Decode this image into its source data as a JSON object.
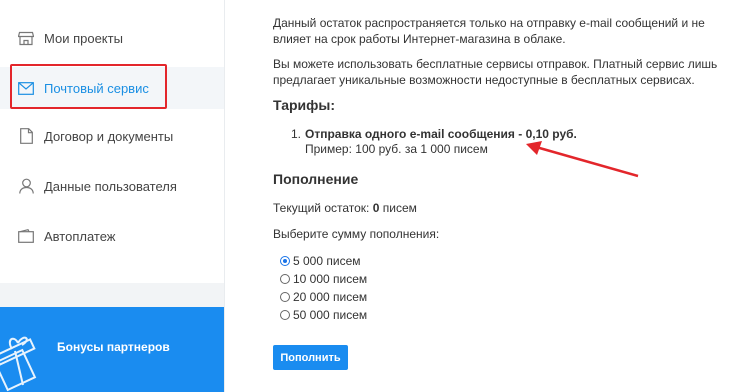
{
  "sidebar": {
    "items": [
      {
        "label": "Мои проекты",
        "icon": "store-icon"
      },
      {
        "label": "Почтовый сервис",
        "icon": "envelope-icon"
      },
      {
        "label": "Договор и документы",
        "icon": "document-icon"
      },
      {
        "label": "Данные пользователя",
        "icon": "user-icon"
      },
      {
        "label": "Автоплатеж",
        "icon": "wallet-icon"
      }
    ],
    "active_index": 1,
    "bonus_label": "Бонусы партнеров"
  },
  "main": {
    "intro_1": "Данный остаток распространяется только на отправку e-mail сообщений и не влияет на срок работы Интернет-магазина в облаке.",
    "intro_2": "Вы можете использовать бесплатные сервисы отправок. Платный сервис лишь предлагает уникальные возможности недоступные в бесплатных сервисах.",
    "tariffs_title": "Тарифы:",
    "tariff": {
      "number": "1.",
      "name": "Отправка одного e-mail сообщения - 0,10 руб.",
      "example": "Пример: 100 руб. за 1 000 писем"
    },
    "topup_title": "Пополнение",
    "balance_prefix": "Текущий остаток:",
    "balance_value": "0",
    "balance_suffix": "писем",
    "choose_label": "Выберите сумму пополнения:",
    "options": [
      "5 000 писем",
      "10 000 писем",
      "20 000 писем",
      "50 000 писем"
    ],
    "selected_option": 0,
    "submit_label": "Пополнить"
  },
  "colors": {
    "accent": "#1a8cf0",
    "annotation_red": "#e3262b"
  }
}
